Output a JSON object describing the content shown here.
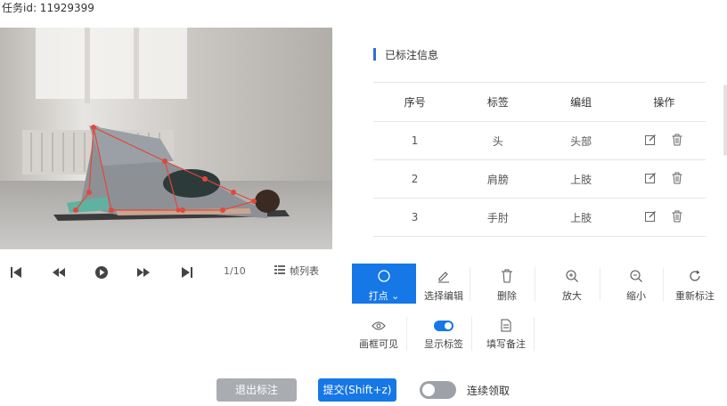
{
  "task": {
    "label": "任务id: 11929399"
  },
  "player": {
    "frame_counter": "1/10",
    "frame_list_label": "帧列表"
  },
  "panel": {
    "title": "已标注信息",
    "headers": [
      "序号",
      "标签",
      "编组",
      "操作"
    ],
    "rows": [
      {
        "index": "1",
        "label": "头",
        "group": "头部"
      },
      {
        "index": "2",
        "label": "肩膀",
        "group": "上肢"
      },
      {
        "index": "3",
        "label": "手肘",
        "group": "上肢"
      }
    ]
  },
  "toolbar": {
    "point_label": "打点",
    "select_edit_label": "选择编辑",
    "delete_label": "删除",
    "zoom_in_label": "放大",
    "zoom_out_label": "缩小",
    "relabel_label": "重新标注",
    "frame_visible_label": "画框可见",
    "show_label_label": "显示标签",
    "notes_label": "填写备注"
  },
  "footer": {
    "exit_label": "退出标注",
    "submit_label": "提交(Shift+z)",
    "continuous_label": "连续领取"
  },
  "colors": {
    "accent": "#1677e6",
    "keypoint": "#e0483a"
  }
}
